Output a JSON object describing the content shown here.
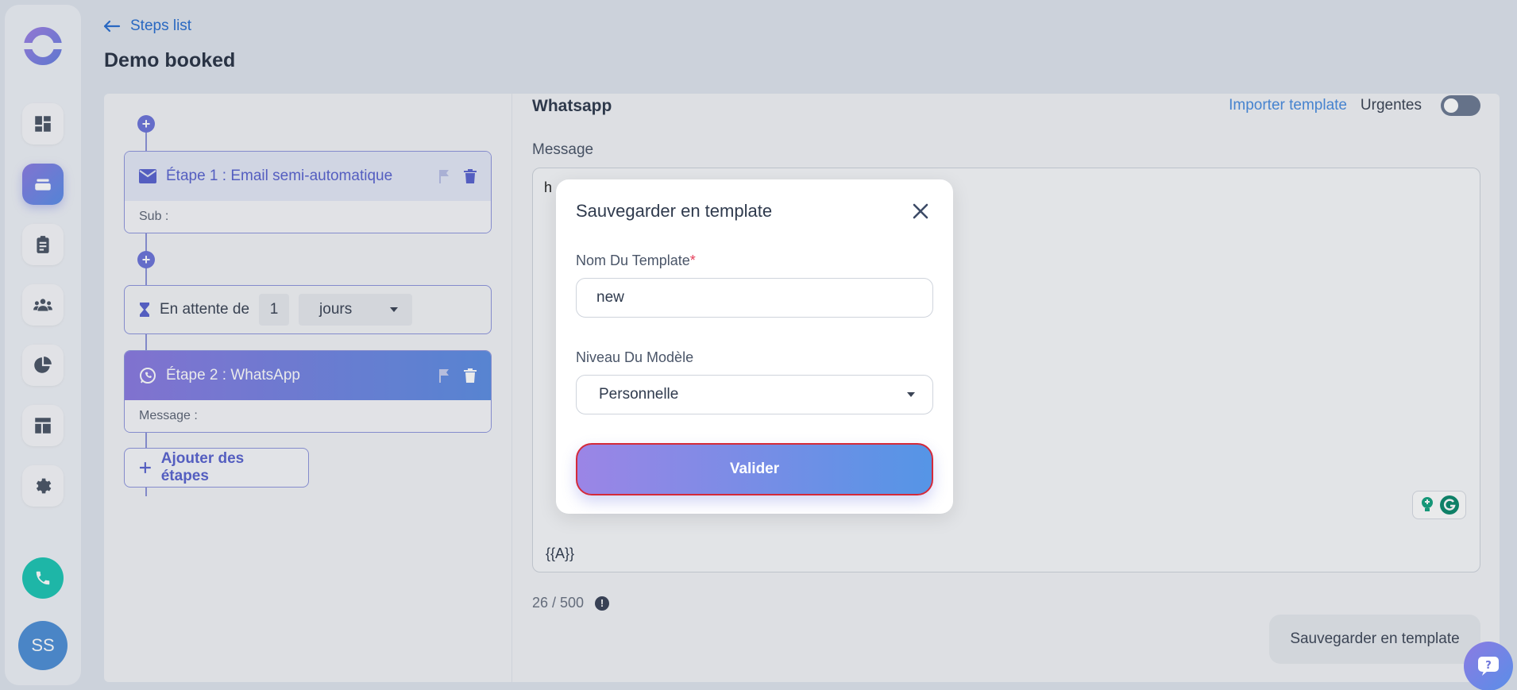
{
  "header": {
    "back_label": "Steps list",
    "title": "Demo booked"
  },
  "sidebar": {
    "avatar_initials": "SS",
    "items": [
      {
        "icon": "dashboard-icon"
      },
      {
        "icon": "sequences-icon",
        "active": true
      },
      {
        "icon": "clipboard-icon"
      },
      {
        "icon": "contacts-icon"
      },
      {
        "icon": "pie-chart-icon"
      },
      {
        "icon": "layout-icon"
      },
      {
        "icon": "gear-icon"
      }
    ]
  },
  "steps": {
    "step1_title": "Étape 1 : Email semi-automatique",
    "step1_body": "Sub :",
    "wait_prefix": "En attente de",
    "wait_value": "1",
    "wait_unit": "jours",
    "step2_title": "Étape 2 : WhatsApp",
    "step2_body": "Message :",
    "add_steps_label": "Ajouter des étapes"
  },
  "editor": {
    "channel_title": "Whatsapp",
    "import_label": "Importer template",
    "urgent_label": "Urgentes",
    "urgent_on": false,
    "message_label": "Message",
    "message_text": "h",
    "variable_text": "{{A}}",
    "counter": "26 / 500",
    "save_template_label": "Sauvegarder en template"
  },
  "modal": {
    "title": "Sauvegarder en template",
    "name_label": "Nom Du Template",
    "name_required_mark": "*",
    "name_value": "new",
    "level_label": "Niveau Du Modèle",
    "level_value": "Personnelle",
    "submit_label": "Valider"
  },
  "colors": {
    "accent_start": "#9b85e6",
    "accent_end": "#5595e6",
    "link": "#2a6fd1",
    "phone": "#1ec6b4"
  }
}
